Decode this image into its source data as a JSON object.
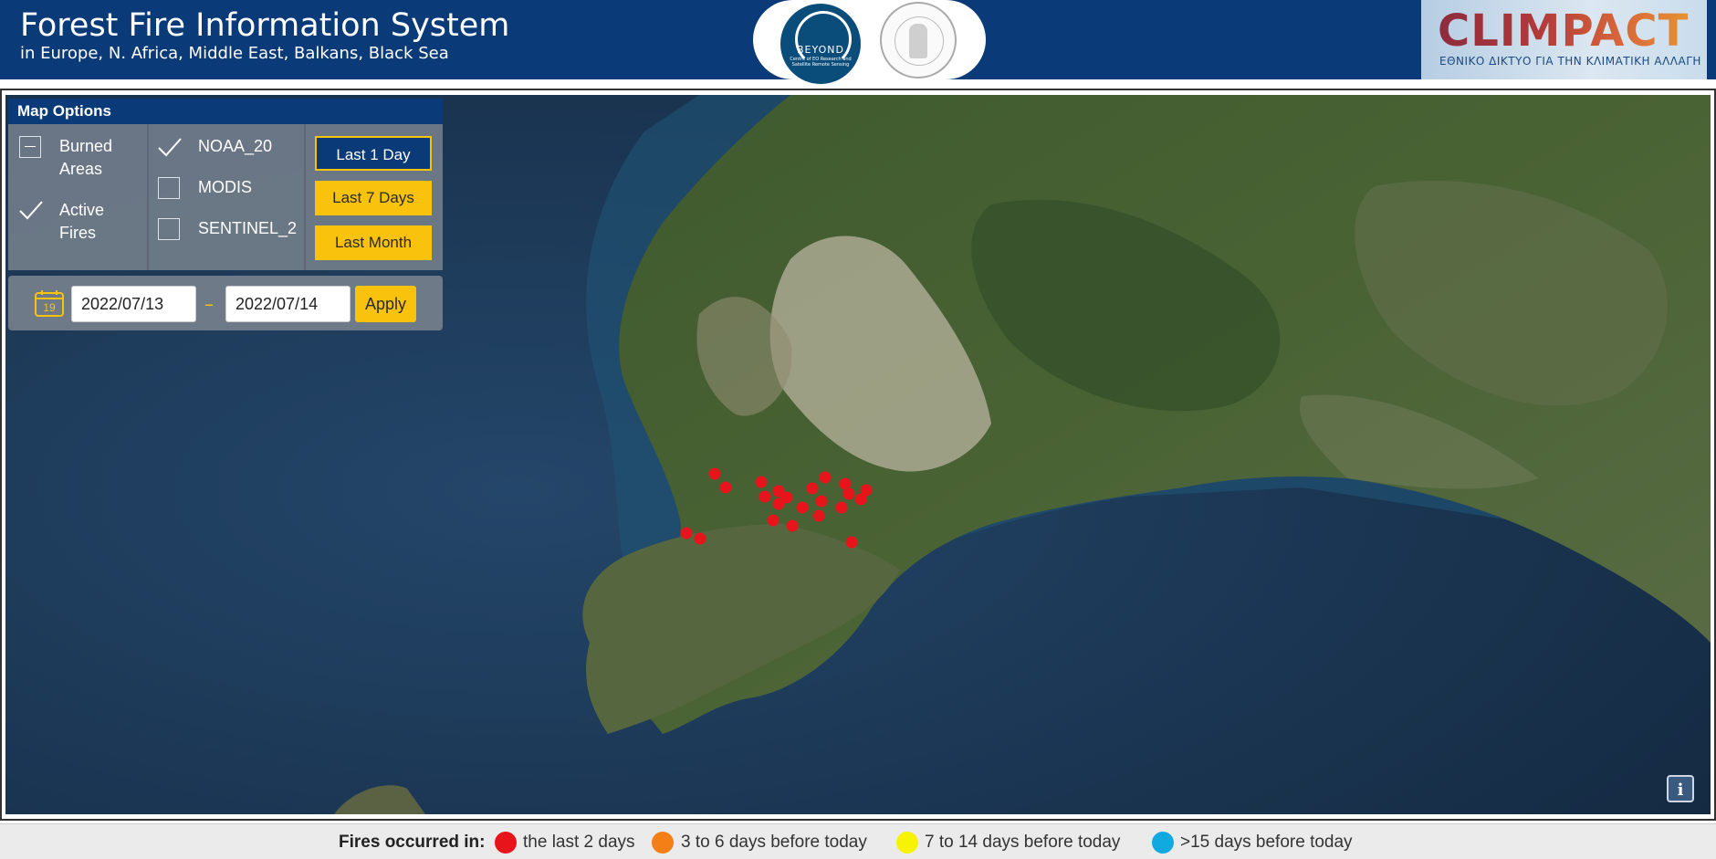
{
  "header": {
    "title": "Forest Fire Information System",
    "subtitle": "in Europe, N. Africa, Middle East, Balkans, Black Sea",
    "beyond_logo": {
      "name": "BEYOND",
      "tagline": "Centre of EO Research and Satellite Remote Sensing"
    },
    "climpact_logo": {
      "name": "CLIMPACT",
      "tagline": "ΕΘΝΙΚΟ ΔΙΚΤΥΟ ΓΙΑ ΤΗΝ ΚΛΙΜΑΤΙΚΗ ΑΛΛΑΓΗ"
    },
    "colors": {
      "header_bg": "#0a3a78"
    }
  },
  "map_options": {
    "title": "Map Options",
    "layers": [
      {
        "label_line1": "Burned",
        "label_line2": "Areas",
        "state": "indeterminate"
      },
      {
        "label_line1": "Active",
        "label_line2": "Fires",
        "state": "checked"
      }
    ],
    "sensors": [
      {
        "label": "NOAA_20",
        "checked": true
      },
      {
        "label": "MODIS",
        "checked": false
      },
      {
        "label": "SENTINEL_2",
        "checked": false
      }
    ],
    "time_ranges": [
      {
        "label": "Last 1 Day",
        "active": true
      },
      {
        "label": "Last 7 Days",
        "active": false
      },
      {
        "label": "Last Month",
        "active": false
      }
    ]
  },
  "date_filter": {
    "calendar_icon_day": "19",
    "from": "2022/07/13",
    "separator": "–",
    "to": "2022/07/14",
    "apply_label": "Apply"
  },
  "map": {
    "fire_marker_color": "#e8141b",
    "info_label": "i"
  },
  "legend": {
    "title": "Fires occurred in:",
    "items": [
      {
        "label": "the last 2 days",
        "color": "#e8141b"
      },
      {
        "label": "3 to 6 days before today",
        "color": "#f57f17"
      },
      {
        "label": "7 to 14 days before today",
        "color": "#f7f305"
      },
      {
        "label": ">15 days before today",
        "color": "#12a9e0"
      }
    ]
  },
  "icons": [
    "calendar-icon",
    "check-icon",
    "info-icon",
    "fire-marker-icon"
  ]
}
